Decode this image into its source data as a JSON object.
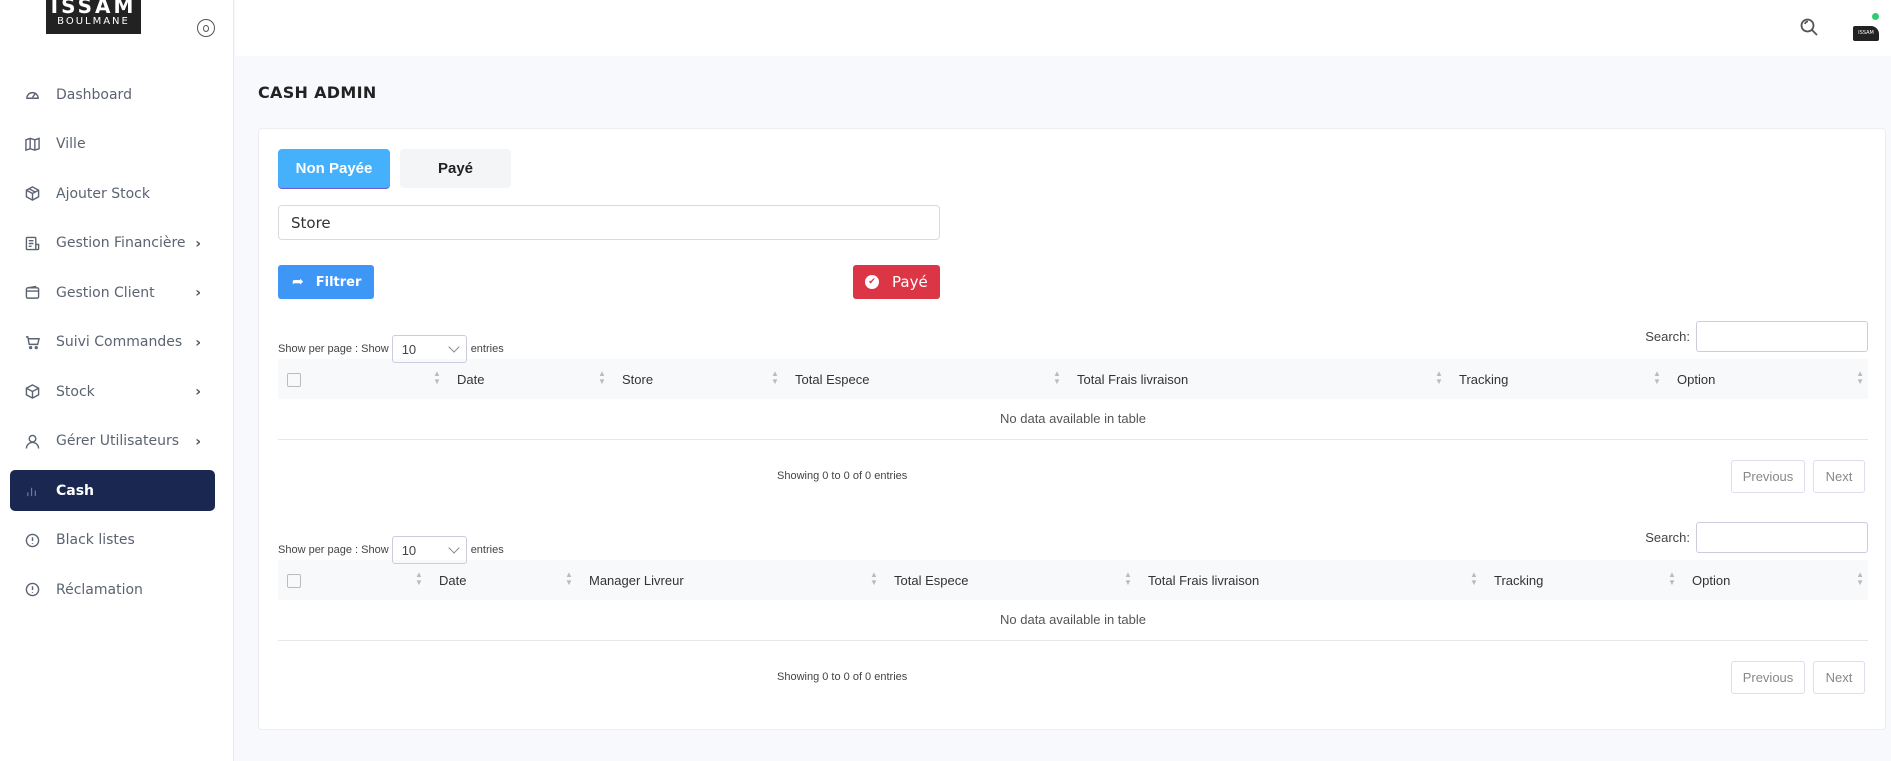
{
  "sidebar": {
    "logo": {
      "line1": "ISSAM",
      "line2": "BOULMANE"
    },
    "items": [
      {
        "label": "Dashboard",
        "icon": "gauge-icon",
        "has_submenu": false,
        "active": false
      },
      {
        "label": "Ville",
        "icon": "map-icon",
        "has_submenu": false,
        "active": false
      },
      {
        "label": "Ajouter Stock",
        "icon": "package-icon",
        "has_submenu": false,
        "active": false
      },
      {
        "label": "Gestion Financière",
        "icon": "receipt-icon",
        "has_submenu": true,
        "active": false
      },
      {
        "label": "Gestion Client",
        "icon": "wallet-icon",
        "has_submenu": true,
        "active": false
      },
      {
        "label": "Suivi Commandes",
        "icon": "cart-icon",
        "has_submenu": true,
        "active": false
      },
      {
        "label": "Stock",
        "icon": "box-icon",
        "has_submenu": true,
        "active": false
      },
      {
        "label": "Gérer Utilisateurs",
        "icon": "user-icon",
        "has_submenu": true,
        "active": false
      },
      {
        "label": "Cash",
        "icon": "bar-chart-icon",
        "has_submenu": false,
        "active": true
      },
      {
        "label": "Black listes",
        "icon": "alert-circle-icon",
        "has_submenu": false,
        "active": false
      },
      {
        "label": "Réclamation",
        "icon": "alert-circle-icon",
        "has_submenu": false,
        "active": false
      }
    ]
  },
  "topbar": {
    "avatar_text": "ISSAM",
    "status_color": "#2ecc71"
  },
  "page": {
    "title": "CASH ADMIN"
  },
  "tabs": {
    "non_payee": "Non Payée",
    "paye": "Payé",
    "active": "non_payee"
  },
  "filter": {
    "store_select_value": "Store",
    "filtrer_label": "Filtrer",
    "paye_label": "Payé"
  },
  "colors": {
    "primary": "#45b1fd",
    "filtrer": "#3e97f7",
    "danger": "#dc3545",
    "sidebar_active": "#1a2851"
  },
  "tables": [
    {
      "length_prefix": "Show per page :  Show",
      "length_value": "10",
      "length_suffix": "entries",
      "search_label": "Search:",
      "columns": [
        "Date",
        "Store",
        "Total Espece",
        "Total Frais livraison",
        "Tracking",
        "Option"
      ],
      "empty_text": "No data available in table",
      "info": "Showing 0 to 0 of 0 entries",
      "previous": "Previous",
      "next": "Next"
    },
    {
      "length_prefix": "Show per page :  Show",
      "length_value": "10",
      "length_suffix": "entries",
      "search_label": "Search:",
      "columns": [
        "Date",
        "Manager Livreur",
        "Total Espece",
        "Total Frais livraison",
        "Tracking",
        "Option"
      ],
      "empty_text": "No data available in table",
      "info": "Showing 0 to 0 of 0 entries",
      "previous": "Previous",
      "next": "Next"
    }
  ]
}
